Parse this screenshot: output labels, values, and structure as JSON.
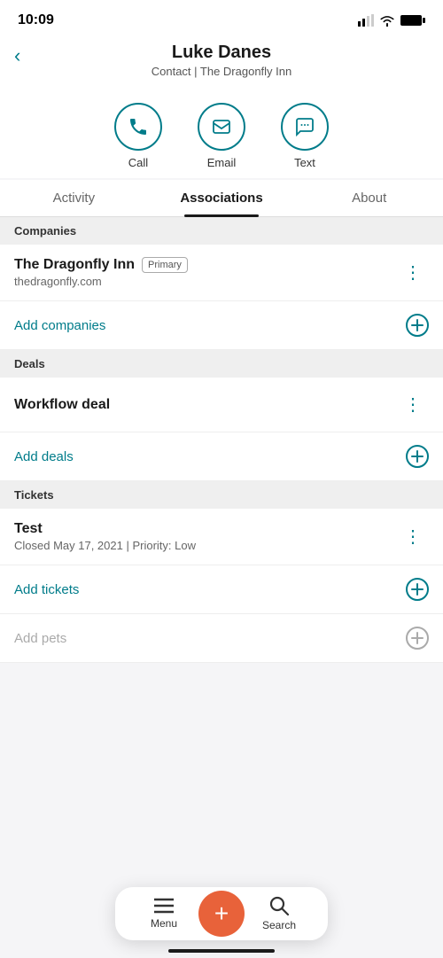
{
  "statusBar": {
    "time": "10:09"
  },
  "header": {
    "backLabel": "‹",
    "contactName": "Luke Danes",
    "contactSub": "Contact | The Dragonfly Inn"
  },
  "actions": [
    {
      "id": "call",
      "label": "Call",
      "icon": "phone-icon"
    },
    {
      "id": "email",
      "label": "Email",
      "icon": "email-icon"
    },
    {
      "id": "text",
      "label": "Text",
      "icon": "text-icon"
    }
  ],
  "tabs": [
    {
      "id": "activity",
      "label": "Activity",
      "active": false
    },
    {
      "id": "associations",
      "label": "Associations",
      "active": true
    },
    {
      "id": "about",
      "label": "About",
      "active": false
    }
  ],
  "sections": [
    {
      "id": "companies",
      "header": "Companies",
      "items": [
        {
          "title": "The Dragonfly Inn",
          "badge": "Primary",
          "sub": "thedragonfly.com"
        }
      ],
      "addLabel": "Add companies",
      "disabled": false
    },
    {
      "id": "deals",
      "header": "Deals",
      "items": [
        {
          "title": "Workflow deal",
          "badge": null,
          "sub": null
        }
      ],
      "addLabel": "Add deals",
      "disabled": false
    },
    {
      "id": "tickets",
      "header": "Tickets",
      "items": [
        {
          "title": "Test",
          "badge": null,
          "sub": "Closed May 17, 2021 | Priority: Low"
        }
      ],
      "addLabel": "Add tickets",
      "disabled": false
    },
    {
      "id": "pets",
      "header": null,
      "items": [],
      "addLabel": "Add pets",
      "disabled": true
    }
  ],
  "bottomNav": {
    "menuLabel": "Menu",
    "plusLabel": "+",
    "searchLabel": "Search"
  }
}
